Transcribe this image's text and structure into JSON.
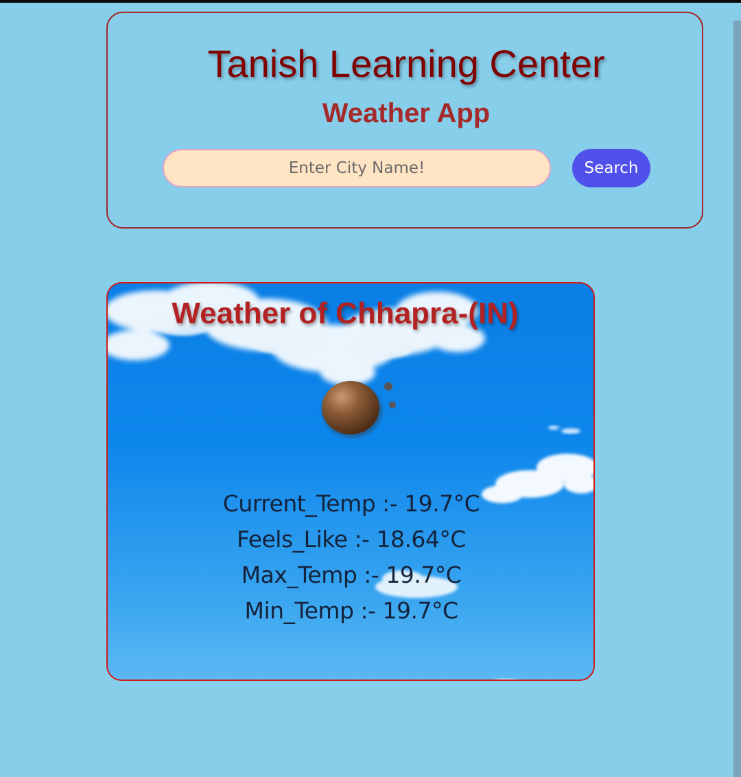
{
  "header": {
    "title": "Tanish Learning Center",
    "subtitle": "Weather App"
  },
  "search": {
    "placeholder": "Enter City Name!",
    "value": "",
    "button_label": "Search"
  },
  "weather": {
    "heading": "Weather of Chhapra-(IN)",
    "icon": "overcast-clouds-icon",
    "stats": [
      "Current_Temp :- 19.7°C",
      "Feels_Like :- 18.64°C",
      "Max_Temp :- 19.7°C",
      "Min_Temp :- 19.7°C"
    ]
  },
  "colors": {
    "page_background": "#87ceeb",
    "title": "#800000",
    "subtitle": "#a52a2a",
    "input_background": "#ffe4c4",
    "button": "#5050ea",
    "card_border": "#d11a1a",
    "sky": "#0a7fe6"
  }
}
